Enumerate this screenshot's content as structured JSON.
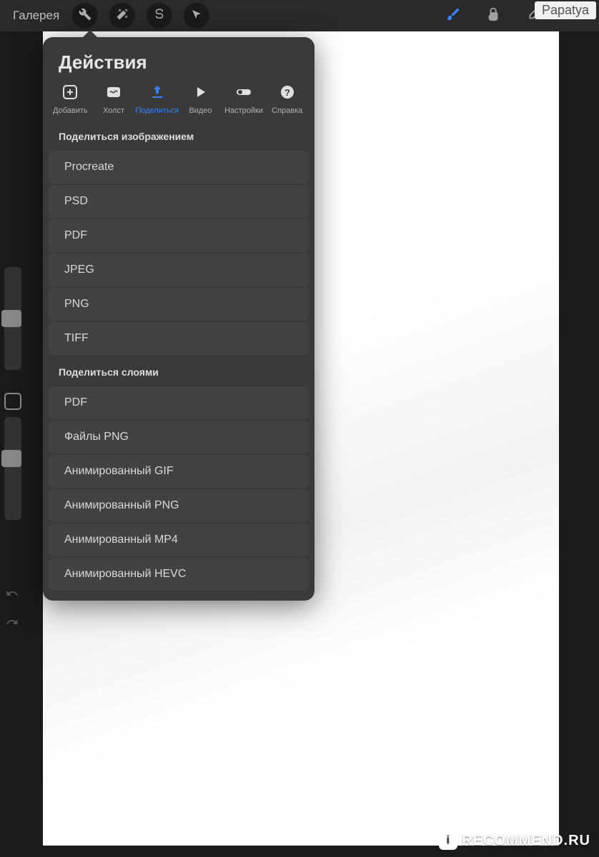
{
  "topbar": {
    "gallery": "Галерея"
  },
  "watermark": {
    "username": "Papatya",
    "site": "RECOMMEND.RU"
  },
  "popover": {
    "title": "Действия",
    "tabs": [
      {
        "label": "Добавить",
        "icon": "add"
      },
      {
        "label": "Холст",
        "icon": "canvas"
      },
      {
        "label": "Поделиться",
        "icon": "share",
        "active": true
      },
      {
        "label": "Видео",
        "icon": "video"
      },
      {
        "label": "Настройки",
        "icon": "settings"
      },
      {
        "label": "Справка",
        "icon": "help"
      }
    ],
    "sections": [
      {
        "header": "Поделиться изображением",
        "items": [
          "Procreate",
          "PSD",
          "PDF",
          "JPEG",
          "PNG",
          "TIFF"
        ]
      },
      {
        "header": "Поделиться слоями",
        "items": [
          "PDF",
          "Файлы PNG",
          "Анимированный GIF",
          "Анимированный PNG",
          "Анимированный MP4",
          "Анимированный HEVC"
        ]
      }
    ]
  }
}
